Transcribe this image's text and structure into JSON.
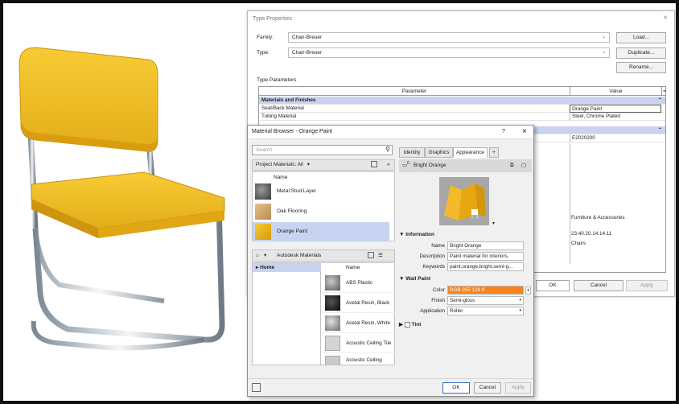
{
  "type_properties": {
    "title": "Type Properties",
    "close": "×",
    "family_label": "Family:",
    "family_value": "Chair-Breuer",
    "type_label": "Type:",
    "type_value": "Chair-Breuer",
    "load_button": "Load...",
    "duplicate_button": "Duplicate...",
    "rename_button": "Rename...",
    "section_label": "Type Parameters",
    "col_parameter": "Parameter",
    "col_value": "Value",
    "collapse_glyph": "»",
    "rows": [
      {
        "param": "Materials and Finishes",
        "value": "",
        "category": true
      },
      {
        "param": "Seat/Back Material",
        "value": "Orange Paint"
      },
      {
        "param": "Tubing Material",
        "value": "Steel, Chrome Plated"
      }
    ],
    "hidden_values": [
      "E2020200",
      "Furniture & Accessories",
      "23.40.20.14.14.11",
      "Chairs"
    ],
    "ok_button": "OK",
    "cancel_button": "Cancel",
    "apply_button": "Apply"
  },
  "material_browser": {
    "title": "Material Browser - Orange Paint",
    "help": "?",
    "close": "×",
    "search_placeholder": "Search",
    "project_materials_label": "Project Materials: All",
    "list_header": "Name",
    "project_items": [
      {
        "name": "Metal Stud Layer",
        "color": "#5a5a5a"
      },
      {
        "name": "Oak Flooring",
        "color": "#c9a46b"
      },
      {
        "name": "Orange Paint",
        "color": "#e8b21b",
        "selected": true
      }
    ],
    "library_label": "Autodesk Materials",
    "tree_home": "Home",
    "library_header": "Name",
    "library_items": [
      {
        "name": "ABS Plastic",
        "color": "#8c8c8c"
      },
      {
        "name": "Acetal Resin, Black",
        "color": "#1c1c1c"
      },
      {
        "name": "Acetal Resin, White",
        "color": "#9a9a9a"
      },
      {
        "name": "Acoustic Ceiling Tile",
        "color": "#cfcfcf"
      },
      {
        "name": "Acoustic Ceiling",
        "color": "#c4c4c4"
      }
    ],
    "tabs": [
      "Identity",
      "Graphics",
      "Appearance"
    ],
    "add_tab": "+",
    "asset_name": "Bright Orange",
    "asset_count": "0",
    "information_header": "Information",
    "name_label": "Name",
    "name_value": "Bright Orange",
    "description_label": "Description",
    "description_value": "Paint material for interiors.",
    "keywords_label": "Keywords",
    "keywords_value": "paint,orange,bright,semi-g...",
    "wall_paint_header": "Wall Paint",
    "color_label": "Color",
    "color_value": "RGB 255 128 0",
    "color_swatch": "#f7831c",
    "finish_label": "Finish",
    "finish_value": "Semi-gloss",
    "application_label": "Application",
    "application_value": "Roller",
    "tint_label": "Tint",
    "ok_button": "OK",
    "cancel_button": "Cancel",
    "apply_button": "Apply",
    "collapse_glyph": "«"
  },
  "colors": {
    "chair_yellow": "#f2c12e",
    "selection": "#c7d3f0",
    "category_row": "#c9d3f0"
  }
}
